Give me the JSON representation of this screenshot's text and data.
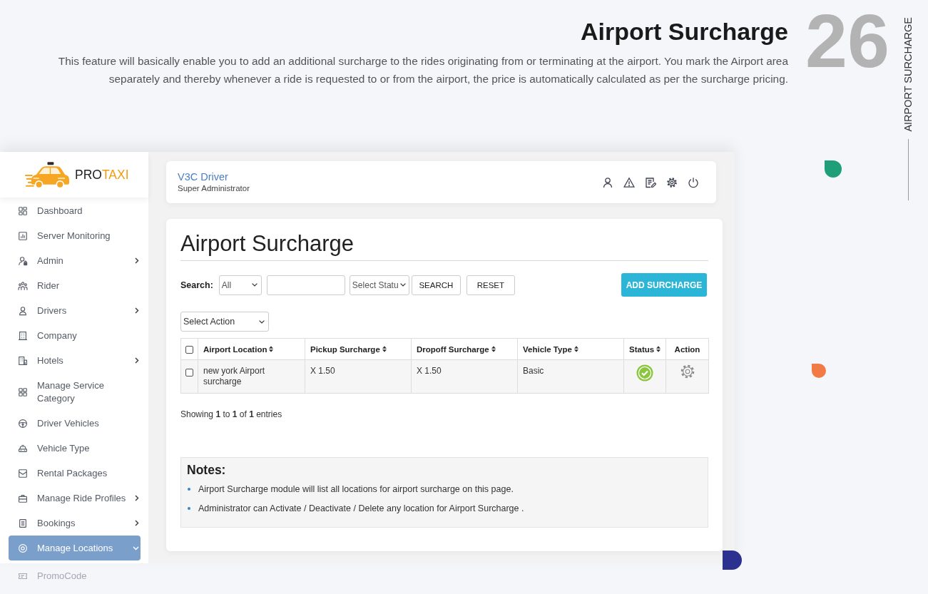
{
  "header": {
    "title": "Airport Surcharge",
    "description": "This feature will basically enable you to add an additional surcharge to the rides originating from or terminating at the airport. You mark the Airport area separately and thereby whenever a ride is requested to or from the airport, the price is automatically calculated as per the surcharge pricing.",
    "number": "26",
    "side_label": "AIRPORT SURCHARGE"
  },
  "sidebar": {
    "logo": {
      "parts": [
        "PRO",
        "TAXI"
      ]
    },
    "items": [
      {
        "label": "Dashboard",
        "selected": false,
        "faded": false
      },
      {
        "label": "Server Monitoring",
        "selected": false,
        "faded": false
      },
      {
        "label": "Admin",
        "expanded": false,
        "selected": false,
        "faded": false
      },
      {
        "label": "Rider",
        "selected": false,
        "faded": false
      },
      {
        "label": "Drivers",
        "expanded": false,
        "selected": false,
        "faded": false
      },
      {
        "label": "Company",
        "selected": false,
        "faded": false
      },
      {
        "label": "Hotels",
        "expanded": false,
        "selected": false,
        "faded": false
      },
      {
        "label": "Manage Service Category",
        "selected": false,
        "faded": false
      },
      {
        "label": "Driver Vehicles",
        "selected": false,
        "faded": false
      },
      {
        "label": "Vehicle Type",
        "selected": false,
        "faded": false
      },
      {
        "label": "Rental Packages",
        "selected": false,
        "faded": false
      },
      {
        "label": "Manage Ride Profiles",
        "expanded": false,
        "selected": false,
        "faded": false
      },
      {
        "label": "Bookings",
        "expanded": false,
        "selected": false,
        "faded": false
      },
      {
        "label": "Manage Locations",
        "expanded": true,
        "selected": true,
        "faded": false
      },
      {
        "label": "PromoCode",
        "selected": false,
        "faded": true
      }
    ]
  },
  "topbar": {
    "user_name": "V3C Driver",
    "user_role": "Super Administrator"
  },
  "content": {
    "title": "Airport Surcharge",
    "filters": {
      "search_label": "Search:",
      "search_by": "All",
      "status_select": "Select Statu",
      "search_button": "SEARCH",
      "reset_button": "RESET",
      "add_button": "ADD SURCHARGE"
    },
    "bulk_action": "Select Action",
    "table": {
      "select_all_checked": false,
      "columns": [
        {
          "label": "Airport Location",
          "sortable": true
        },
        {
          "label": "Pickup Surcharge",
          "sortable": true
        },
        {
          "label": "Dropoff Surcharge",
          "sortable": true
        },
        {
          "label": "Vehicle Type",
          "sortable": true
        },
        {
          "label": "Status",
          "sortable": true
        },
        {
          "label": "Action",
          "sortable": false
        }
      ],
      "rows": [
        {
          "checked": false,
          "cells": [
            "new york Airport surcharge",
            "X 1.50",
            "X 1.50",
            "Basic"
          ],
          "active": true
        }
      ]
    },
    "info": "Showing **1** to **1** of **1** entries",
    "notes": {
      "title": "Notes:",
      "items": [
        "Airport Surcharge module will list all locations for airport surcharge on this page.",
        "Administrator can Activate / Deactivate / Delete any location for Airport Surcharge ."
      ]
    }
  }
}
